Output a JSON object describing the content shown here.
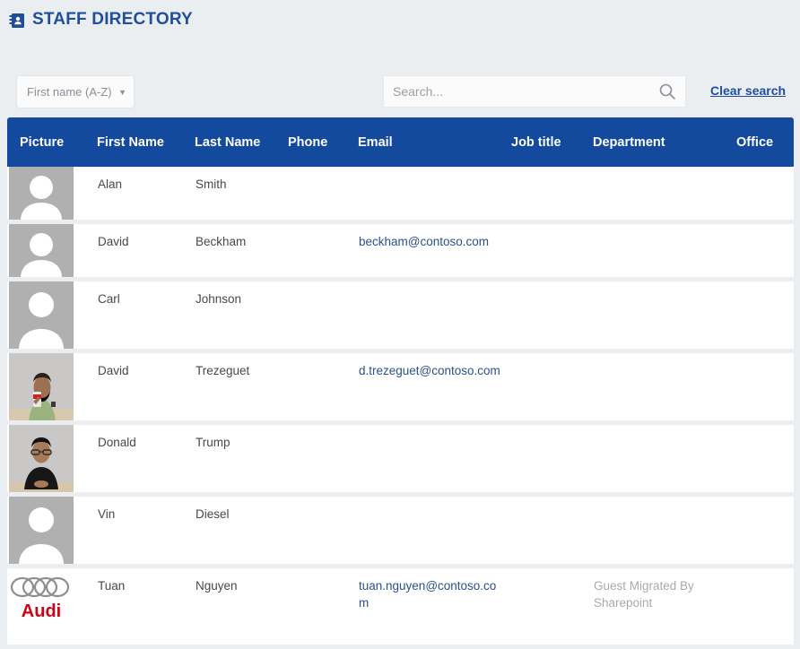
{
  "header": {
    "icon": "address-book-icon",
    "title": "STAFF DIRECTORY",
    "title_color": "#1f4e9c"
  },
  "toolbar": {
    "sort": {
      "selected": "First name (A-Z)",
      "caret": "▼",
      "options": [
        "First name (A-Z)"
      ]
    },
    "search": {
      "value": "",
      "placeholder": "Search...",
      "icon": "search-icon"
    },
    "clear_search_label": "Clear search"
  },
  "table": {
    "header_bg": "#144a9e",
    "columns": [
      {
        "key": "picture",
        "label": "Picture"
      },
      {
        "key": "first_name",
        "label": "First Name"
      },
      {
        "key": "last_name",
        "label": "Last Name"
      },
      {
        "key": "phone",
        "label": "Phone"
      },
      {
        "key": "email",
        "label": "Email"
      },
      {
        "key": "job_title",
        "label": "Job title"
      },
      {
        "key": "department",
        "label": "Department"
      },
      {
        "key": "office",
        "label": "Office"
      }
    ],
    "rows": [
      {
        "picture": "default-avatar",
        "first_name": "Alan",
        "last_name": "Smith",
        "phone": "",
        "email": "",
        "job_title": "",
        "department": "",
        "office": ""
      },
      {
        "picture": "default-avatar",
        "first_name": "David",
        "last_name": "Beckham",
        "phone": "",
        "email": "beckham@contoso.com",
        "job_title": "",
        "department": "",
        "office": ""
      },
      {
        "picture": "default-avatar",
        "first_name": "Carl",
        "last_name": "Johnson",
        "phone": "",
        "email": "",
        "job_title": "",
        "department": "",
        "office": ""
      },
      {
        "picture": "photo-man-green-shirt",
        "first_name": "David",
        "last_name": "Trezeguet",
        "phone": "",
        "email": "d.trezeguet@contoso.com",
        "job_title": "",
        "department": "",
        "office": ""
      },
      {
        "picture": "photo-man-black-shirt",
        "first_name": "Donald",
        "last_name": "Trump",
        "phone": "",
        "email": "",
        "job_title": "",
        "department": "",
        "office": ""
      },
      {
        "picture": "default-avatar",
        "first_name": "Vin",
        "last_name": "Diesel",
        "phone": "",
        "email": "",
        "job_title": "",
        "department": "",
        "office": ""
      },
      {
        "picture": "audi-logo",
        "first_name": "Tuan",
        "last_name": "Nguyen",
        "phone": "",
        "email": "tuan.nguyen@contoso.com",
        "job_title": "",
        "department": "Guest Migrated By Sharepoint",
        "office": ""
      }
    ]
  }
}
